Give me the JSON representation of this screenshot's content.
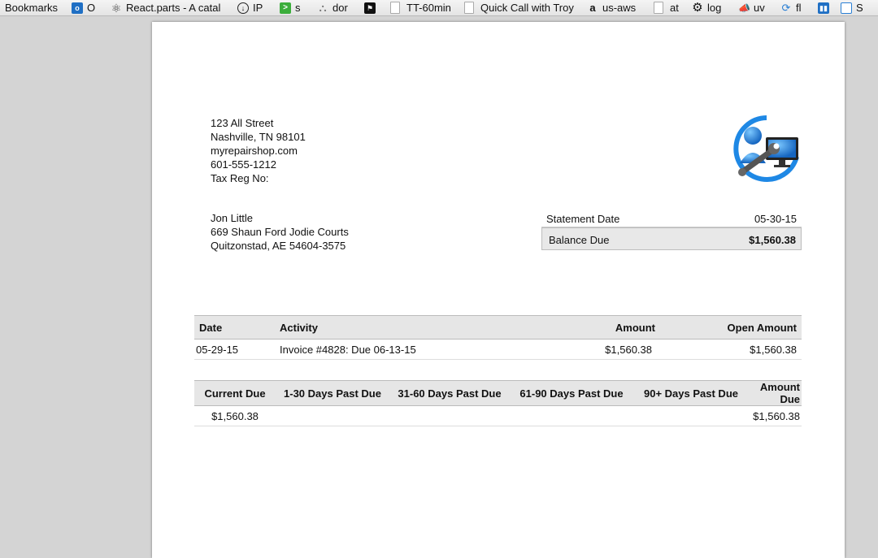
{
  "bookmarks_bar": {
    "items": [
      {
        "label": "Bookmarks",
        "icon": ""
      },
      {
        "label": "O",
        "icon": "outlook-icon"
      },
      {
        "label": "React.parts - A catal",
        "icon": "react-icon"
      },
      {
        "label": "IP",
        "icon": "download-circle-icon"
      },
      {
        "label": "s",
        "icon": "terminal-icon"
      },
      {
        "label": "dor",
        "icon": "chart-icon"
      },
      {
        "label": "",
        "icon": "flag-icon"
      },
      {
        "label": "TT-60min",
        "icon": "document-icon"
      },
      {
        "label": "Quick Call with Troy",
        "icon": "document-icon"
      },
      {
        "label": "us-aws",
        "icon": "amazon-icon"
      },
      {
        "label": "at",
        "icon": "document-icon"
      },
      {
        "label": "log",
        "icon": "gear-icon"
      },
      {
        "label": "uv",
        "icon": "megaphone-icon"
      },
      {
        "label": "fl",
        "icon": "sync-icon"
      },
      {
        "label": "",
        "icon": "trello-icon"
      },
      {
        "label": "S",
        "icon": "panel-icon"
      }
    ]
  },
  "company": {
    "street": "123 All Street",
    "city_line": "Nashville, TN 98101",
    "website": "myrepairshop.com",
    "phone": "601-555-1212",
    "tax_reg": "Tax Reg No:"
  },
  "customer": {
    "name": "Jon Little",
    "street": "669 Shaun Ford Jodie Courts",
    "city_line": "Quitzonstad, AE 54604-3575"
  },
  "statement": {
    "date_label": "Statement Date",
    "date_value": "05-30-15",
    "balance_label": "Balance Due",
    "balance_value": "$1,560.38"
  },
  "activity_table": {
    "headers": {
      "date": "Date",
      "activity": "Activity",
      "amount": "Amount",
      "open_amount": "Open Amount"
    },
    "rows": [
      {
        "date": "05-29-15",
        "activity": "Invoice #4828: Due 06-13-15",
        "amount": "$1,560.38",
        "open_amount": "$1,560.38"
      }
    ]
  },
  "aging_table": {
    "headers": {
      "current": "Current Due",
      "d1_30": "1-30 Days Past Due",
      "d31_60": "31-60 Days Past Due",
      "d61_90": "61-90 Days Past Due",
      "d90_plus": "90+ Days Past Due",
      "amount_due": "Amount Due"
    },
    "row": {
      "current": "$1,560.38",
      "d1_30": "",
      "d31_60": "",
      "d61_90": "",
      "d90_plus": "",
      "amount_due": "$1,560.38"
    }
  }
}
